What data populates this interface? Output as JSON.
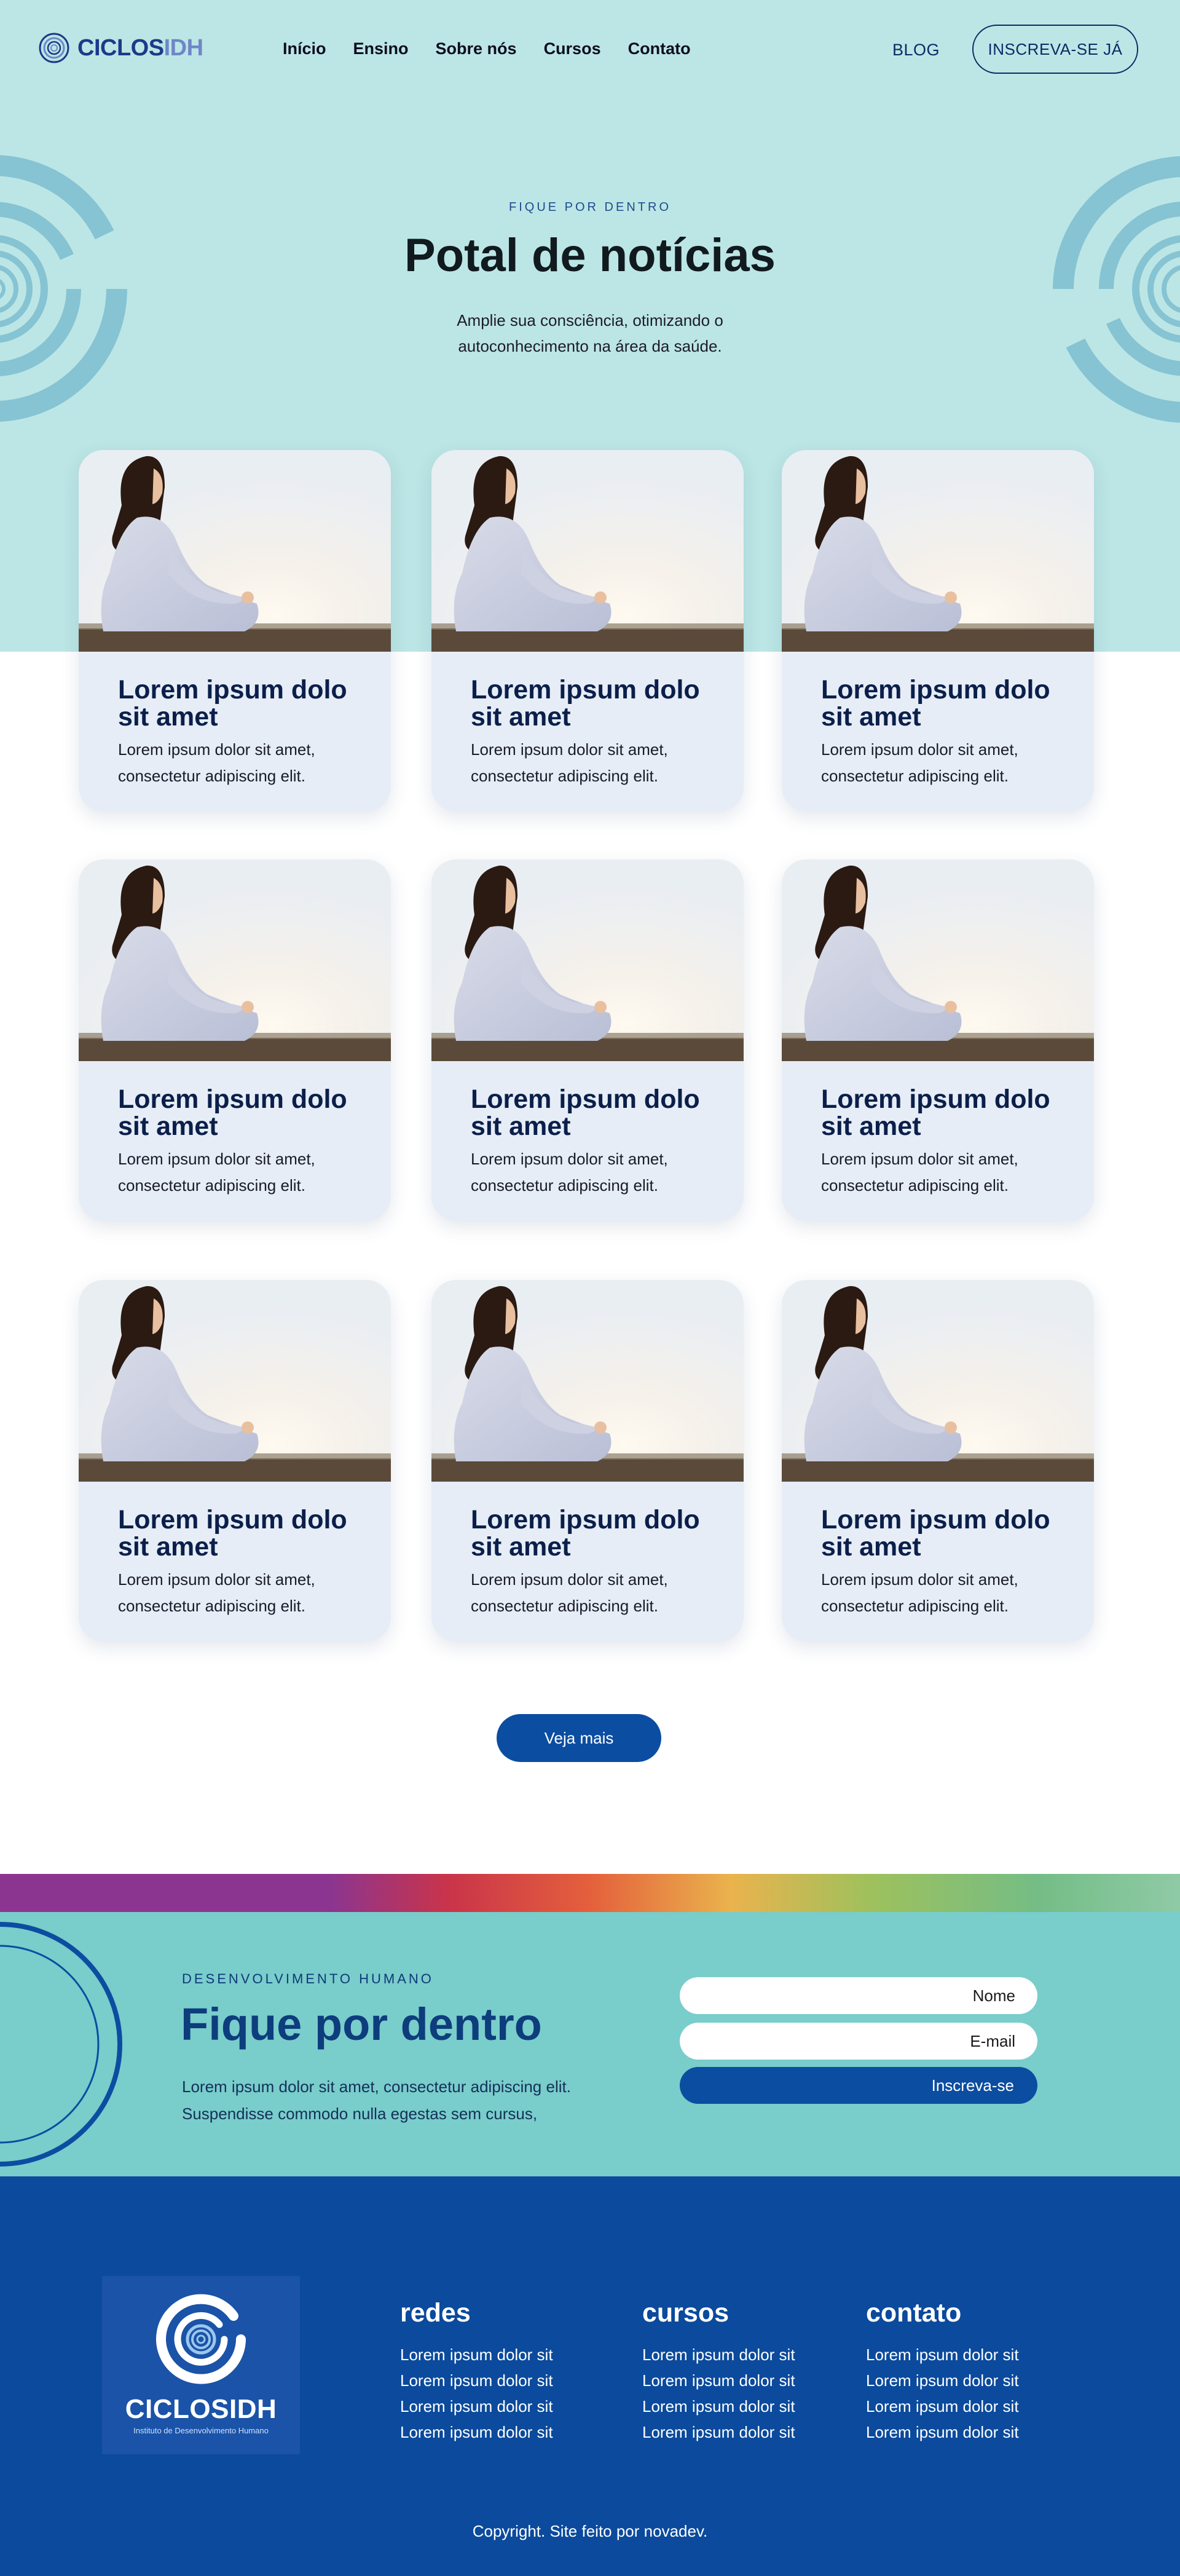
{
  "brand": {
    "logo_part1": "CICLOS",
    "logo_part2": "IDH",
    "footer_name": "CICLOSIDH",
    "footer_tagline": "Instituto de Desenvolvimento Humano",
    "colors": {
      "hero_bg": "#bce6e5",
      "primary": "#0b4da1",
      "footer_bg": "#0b4a9c",
      "newsletter_bg": "#79cdcb",
      "card_bg": "#e6edf6"
    }
  },
  "nav": {
    "links": [
      "Início",
      "Ensino",
      "Sobre nós",
      "Cursos",
      "Contato"
    ],
    "blog": "BLOG",
    "cta": "INSCREVA-SE JÁ"
  },
  "hero": {
    "kicker": "FIQUE POR DENTRO",
    "title": "Potal de notícias",
    "subtitle": "Amplie sua consciência, otimizando o autoconhecimento na área da saúde."
  },
  "cards": [
    {
      "title": "Lorem ipsum dolo sit amet",
      "text": "Lorem ipsum dolor sit amet, consectetur adipiscing elit.",
      "image": "meditation-photo"
    },
    {
      "title": "Lorem ipsum dolo sit amet",
      "text": "Lorem ipsum dolor sit amet, consectetur adipiscing elit.",
      "image": "meditation-photo"
    },
    {
      "title": "Lorem ipsum dolo sit amet",
      "text": "Lorem ipsum dolor sit amet, consectetur adipiscing elit.",
      "image": "meditation-photo"
    },
    {
      "title": "Lorem ipsum dolo sit amet",
      "text": "Lorem ipsum dolor sit amet, consectetur adipiscing elit.",
      "image": "meditation-photo"
    },
    {
      "title": "Lorem ipsum dolo sit amet",
      "text": "Lorem ipsum dolor sit amet, consectetur adipiscing elit.",
      "image": "meditation-photo"
    },
    {
      "title": "Lorem ipsum dolo sit amet",
      "text": "Lorem ipsum dolor sit amet, consectetur adipiscing elit.",
      "image": "meditation-photo"
    },
    {
      "title": "Lorem ipsum dolo sit amet",
      "text": "Lorem ipsum dolor sit amet, consectetur adipiscing elit.",
      "image": "meditation-photo"
    },
    {
      "title": "Lorem ipsum dolo sit amet",
      "text": "Lorem ipsum dolor sit amet, consectetur adipiscing elit.",
      "image": "meditation-photo"
    },
    {
      "title": "Lorem ipsum dolo sit amet",
      "text": "Lorem ipsum dolor sit amet, consectetur adipiscing elit.",
      "image": "meditation-photo"
    }
  ],
  "more_button": "Veja mais",
  "newsletter": {
    "kicker": "DESENVOLVIMENTO HUMANO",
    "title": "Fique por dentro",
    "text": "Lorem ipsum dolor sit amet, consectetur adipiscing elit. Suspendisse commodo nulla egestas sem cursus,",
    "name_placeholder": "Nome",
    "email_placeholder": "E-mail",
    "submit": "Inscreva-se"
  },
  "footer": {
    "columns": [
      {
        "title": "redes",
        "items": [
          "Lorem ipsum dolor sit",
          "Lorem ipsum dolor sit",
          "Lorem ipsum dolor sit",
          "Lorem ipsum dolor sit"
        ]
      },
      {
        "title": "cursos",
        "items": [
          "Lorem ipsum dolor sit",
          "Lorem ipsum dolor sit",
          "Lorem ipsum dolor sit",
          "Lorem ipsum dolor sit"
        ]
      },
      {
        "title": "contato",
        "items": [
          "Lorem ipsum dolor sit",
          "Lorem ipsum dolor sit",
          "Lorem ipsum dolor sit",
          "Lorem ipsum dolor sit"
        ]
      }
    ],
    "copyright": "Copyright. Site feito por novadev."
  }
}
